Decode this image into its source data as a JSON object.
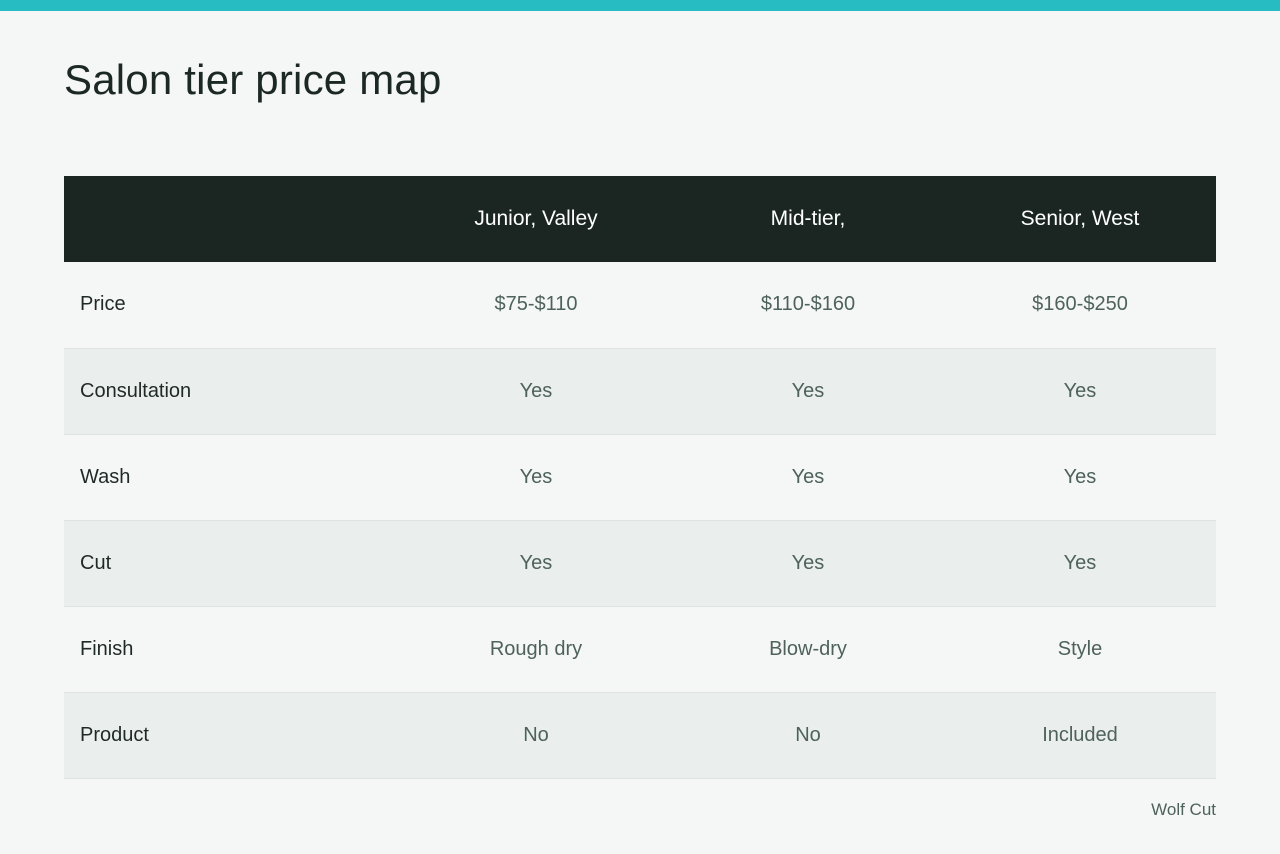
{
  "title": "Salon tier price map",
  "colors": {
    "accent": "#27bcc2",
    "header_bg": "#1b2622",
    "row_alt_bg": "#eaeeec"
  },
  "table": {
    "columns": [
      "",
      "Junior, Valley",
      "Mid-tier,",
      "Senior, West"
    ],
    "rows": [
      {
        "label": "Price",
        "values": [
          "$75-$110",
          "$110-$160",
          "$160-$250"
        ]
      },
      {
        "label": "Consultation",
        "values": [
          "Yes",
          "Yes",
          "Yes"
        ]
      },
      {
        "label": "Wash",
        "values": [
          "Yes",
          "Yes",
          "Yes"
        ]
      },
      {
        "label": "Cut",
        "values": [
          "Yes",
          "Yes",
          "Yes"
        ]
      },
      {
        "label": "Finish",
        "values": [
          "Rough dry",
          "Blow-dry",
          "Style"
        ]
      },
      {
        "label": "Product",
        "values": [
          "No",
          "No",
          "Included"
        ]
      }
    ]
  },
  "footnote": "Wolf Cut"
}
